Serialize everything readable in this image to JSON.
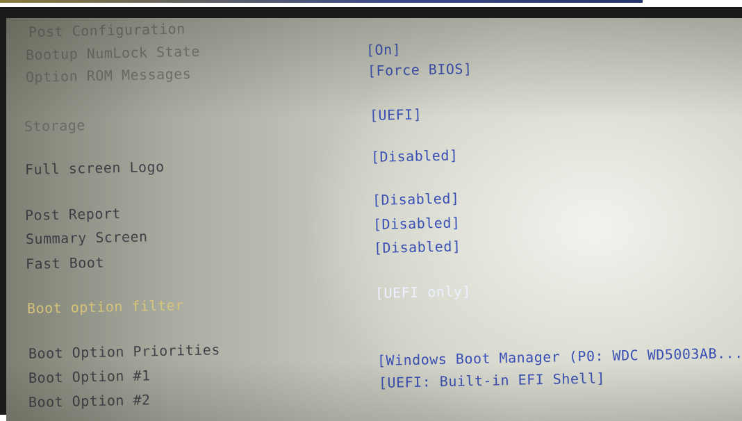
{
  "settings": [
    {
      "label": "Post Configuration",
      "value": ""
    },
    {
      "label": "Bootup NumLock State",
      "value": "[On]"
    },
    {
      "label": "Option ROM Messages",
      "value": "[Force BIOS]"
    },
    {
      "label": "Storage",
      "value": "[UEFI]"
    },
    {
      "label": "Full screen Logo",
      "value": "[Disabled]"
    },
    {
      "label": "Post Report",
      "value": "[Disabled]"
    },
    {
      "label": "Summary Screen",
      "value": "[Disabled]"
    },
    {
      "label": "Fast Boot",
      "value": "[Disabled]"
    },
    {
      "label": "Boot option filter",
      "value": "[UEFI only]"
    },
    {
      "label": "Boot Option Priorities",
      "value": ""
    },
    {
      "label": "Boot Option #1",
      "value": "[Windows Boot Manager (P0: WDC WD5003AB..."
    },
    {
      "label": "Boot Option #2",
      "value": "[UEFI: Built-in EFI Shell]"
    }
  ],
  "selected_item": "Boot option filter",
  "colors": {
    "value_text": "#3a4fb4",
    "label_text": "#2f2f3a",
    "highlight_label": "#d9c67a",
    "highlight_value": "#ecf0ff"
  }
}
